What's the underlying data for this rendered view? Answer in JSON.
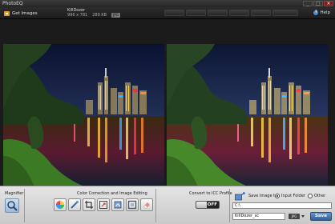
{
  "app": {
    "title": "PhotoEQ"
  },
  "window_controls": {
    "minimize": "_",
    "maximize": "□",
    "close": "×"
  },
  "toolbar": {
    "get_images": "Get Images",
    "file_name": "KillDozer",
    "dimensions": "996 x 781",
    "file_size": "289 KB",
    "format": "JPG",
    "nav_buttons": [
      "",
      "",
      "",
      "",
      "",
      ""
    ],
    "help": "Help"
  },
  "panel": {
    "magnifier_label": "Magnifier",
    "color_correction_label": "Color Correction and Image Editing",
    "tools": [
      "color-wheel-icon",
      "sharpen-icon",
      "crop-icon",
      "resize-icon",
      "rotate-icon",
      "frame-icon",
      "eraser-icon"
    ],
    "icc_label": "Convert to ICC Profile",
    "icc_state": "OFF",
    "icc_enabled": false,
    "save_image_to": "Save Image to",
    "input_folder": "Input Folder",
    "other": "Other",
    "selected_destination": "Input Folder",
    "path": "C:\\",
    "output_name": "KillDozer_sc",
    "output_format": "JPG",
    "save": "Save"
  },
  "colors": {
    "accent": "#2e5e9a",
    "folder": "#e39b2a"
  }
}
